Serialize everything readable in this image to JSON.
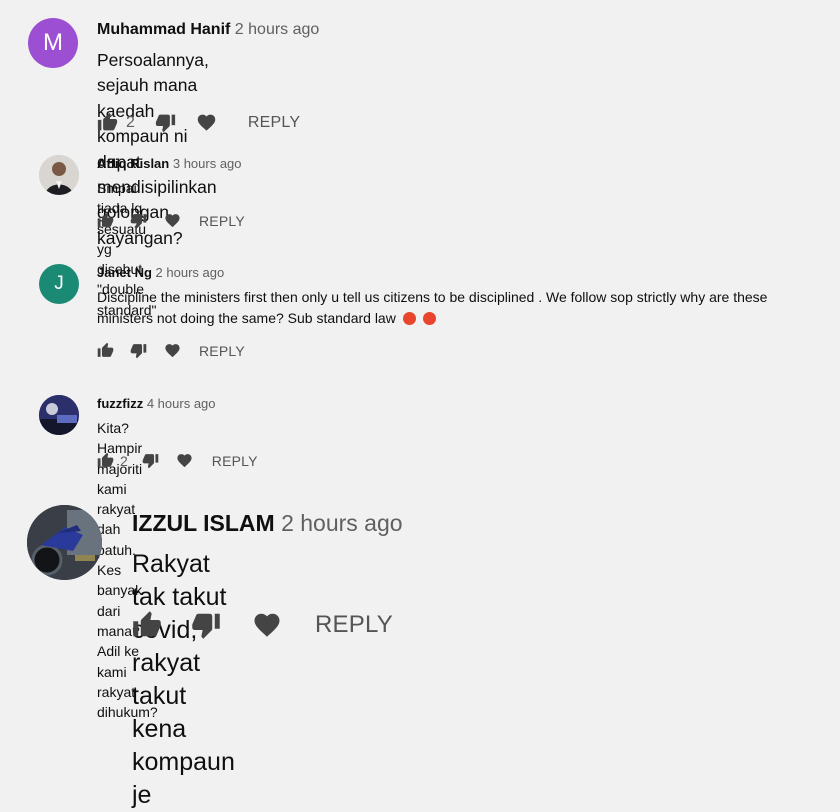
{
  "comments": [
    {
      "author": "Muhammad Hanif",
      "time": "2 hours ago",
      "avatar_letter": "M",
      "avatar_color": "#9c4fd2",
      "text": "Persoalannya, sejauh mana kaedah kompaun ni dapat mendisipilinkan golongan kayangan?",
      "likes": "2",
      "reply_label": "REPLY"
    },
    {
      "author": "Affiq Rislan",
      "time": "3 hours ago",
      "avatar_icon": "person-photo-icon",
      "text": "Smpai tiada lg sesuatu yg disebut \"double standard\"",
      "likes": "",
      "reply_label": "REPLY"
    },
    {
      "author": "Janet Ng",
      "time": "2 hours ago",
      "avatar_letter": "J",
      "avatar_color": "#1b8a74",
      "text_line1": "Discipline the ministers first then only u tell us citizens to be disciplined . We follow sop strictly why are these",
      "text_line2": "ministers not doing the same?  Sub standard law",
      "emoji_icon": "angry-face-icon",
      "likes": "",
      "reply_label": "REPLY"
    },
    {
      "author": "fuzzfizz",
      "time": "4 hours ago",
      "avatar_icon": "landscape-photo-icon",
      "text": "Kita? Hampir majoriti kami rakyat dah patuh. Kes banyak dari mana? Adil ke kami rakyat dihukum?",
      "likes": "2",
      "reply_label": "REPLY"
    },
    {
      "author": "IZZUL ISLAM",
      "time": "2 hours ago",
      "avatar_icon": "motorcycle-photo-icon",
      "text": "Rakyat tak takut covid, rakyat takut kena kompaun je",
      "likes": "",
      "reply_label": "REPLY"
    }
  ],
  "colors": {
    "background": "#f1f1f1",
    "text": "#0f0f0f",
    "secondary_text": "#606060",
    "icon": "#444444"
  }
}
